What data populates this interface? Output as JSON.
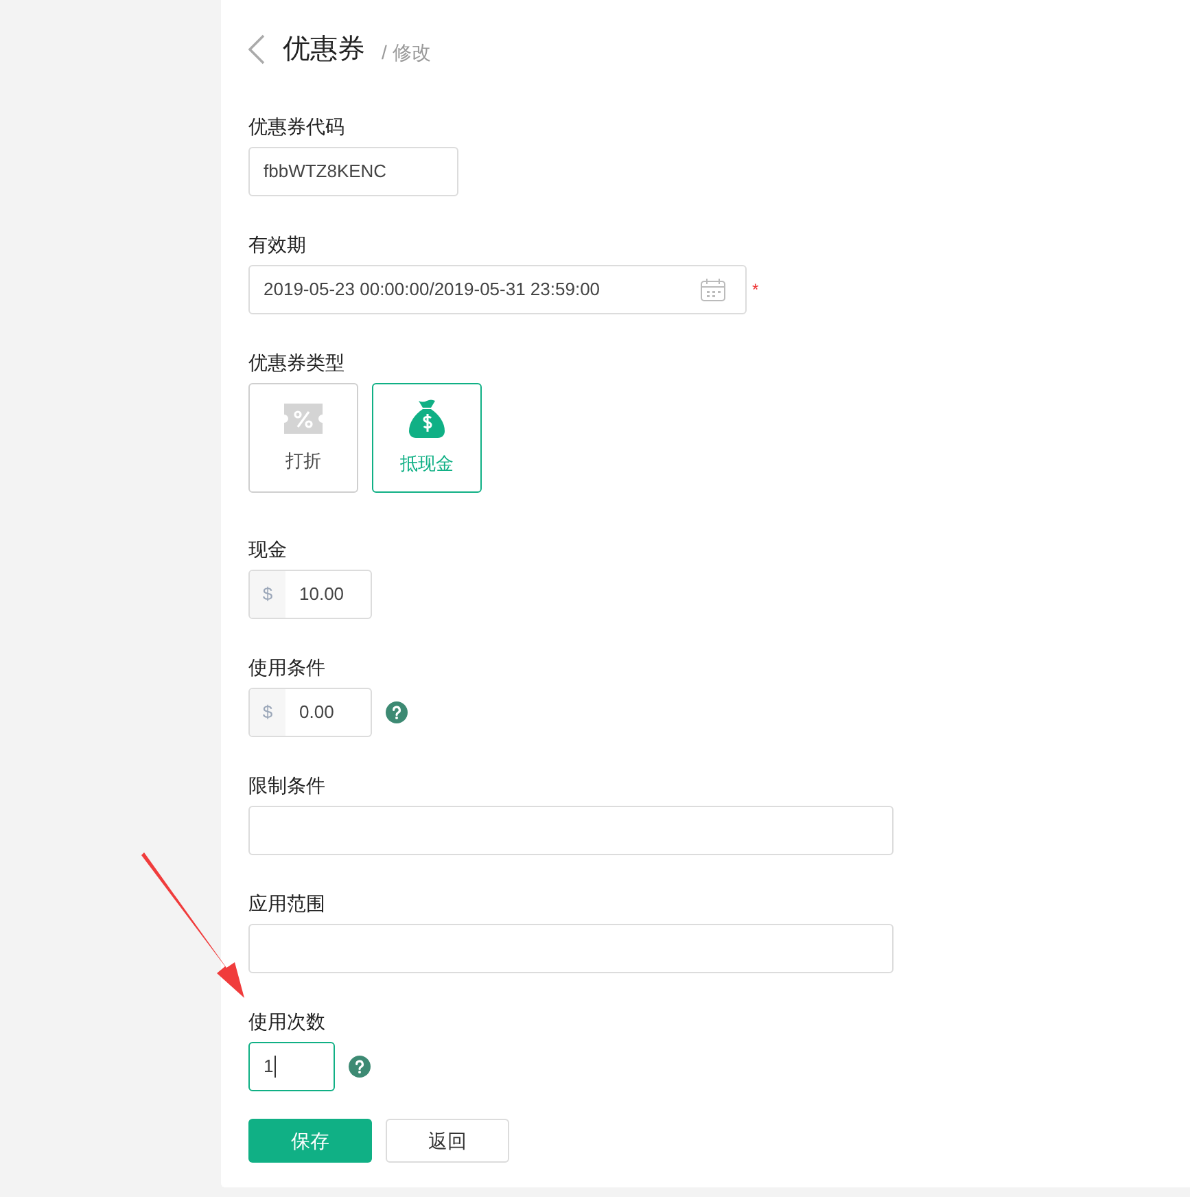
{
  "header": {
    "title": "优惠券",
    "subtitle": "/ 修改"
  },
  "fields": [
    {
      "kind": "text",
      "label": "优惠券代码",
      "value": "fbbWTZ8KENC",
      "focused": false,
      "help": false
    },
    {
      "kind": "date",
      "label": "有效期",
      "value": "2019-05-23 00:00:00/2019-05-31 23:59:00",
      "required": true,
      "required_mark": "*"
    },
    {
      "kind": "choice",
      "label": "优惠券类型",
      "options": [
        {
          "label": "打折",
          "kind": "discount",
          "selected": false
        },
        {
          "label": "抵现金",
          "kind": "cash",
          "selected": true
        }
      ]
    },
    {
      "kind": "money",
      "label": "现金",
      "prefix": "$",
      "value": "10.00",
      "help": false
    },
    {
      "kind": "money",
      "label": "使用条件",
      "prefix": "$",
      "value": "0.00",
      "help": true
    },
    {
      "kind": "line",
      "label": "限制条件",
      "focused": false,
      "help": false
    },
    {
      "kind": "line",
      "label": "应用范围",
      "focused": false,
      "help": false
    },
    {
      "kind": "number",
      "label": "使用次数",
      "value": "1",
      "focused": true,
      "help": true
    }
  ],
  "buttons": [
    {
      "label": "保存",
      "primary": true
    },
    {
      "label": "返回",
      "primary": false
    }
  ]
}
